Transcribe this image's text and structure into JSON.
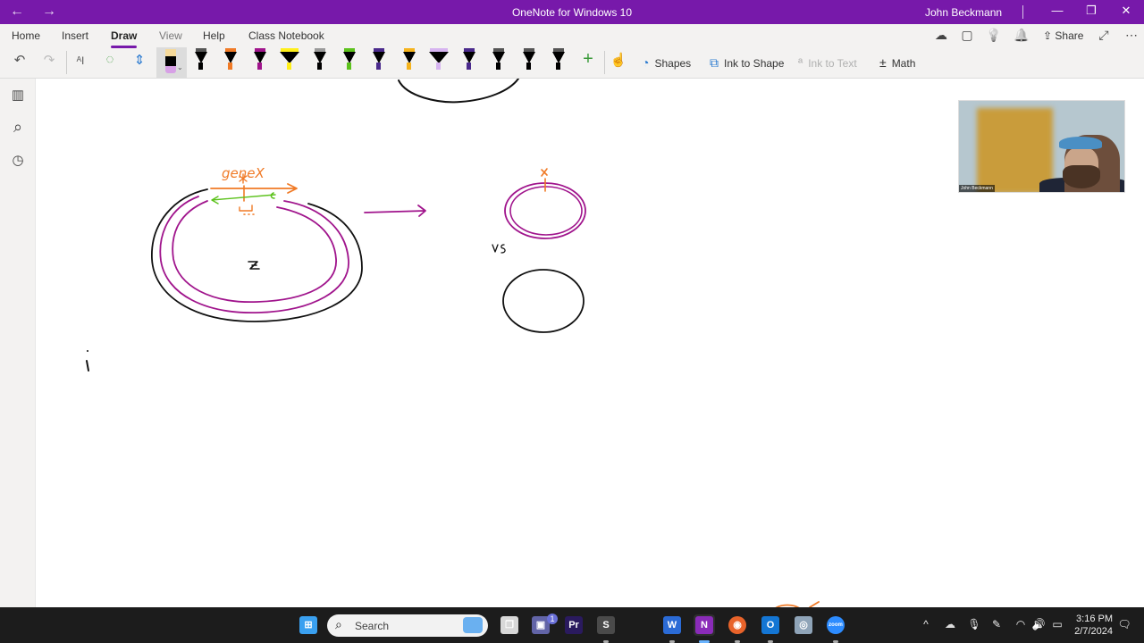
{
  "titlebar": {
    "back_icon": "arrow-left",
    "forward_icon": "arrow-right",
    "title": "OneNote for Windows 10",
    "user": "John Beckmann",
    "minimize_glyph": "—",
    "restore_glyph": "❐",
    "close_glyph": "✕",
    "back_glyph": "←",
    "forward_glyph": "→"
  },
  "ribbon": {
    "tabs": [
      {
        "label": "Home"
      },
      {
        "label": "Insert"
      },
      {
        "label": "Draw",
        "active": true
      },
      {
        "label": "View"
      },
      {
        "label": "Help"
      },
      {
        "label": "Class Notebook"
      }
    ],
    "top_right": {
      "sync_glyph": "☁",
      "pages_glyph": "▢",
      "tell_me_glyph": "💡",
      "notifications_glyph": "🔔",
      "share_label": "Share",
      "share_glyph": "⇪",
      "fullscreen_glyph": "⤢",
      "more_glyph": "⋯"
    },
    "tools": {
      "undo_glyph": "↶",
      "redo_glyph": "↷",
      "type_select_glyph": "ᴬI",
      "lasso_glyph": "◌",
      "add_space_glyph": "⇕",
      "add_pen_glyph": "+",
      "touch_draw_glyph": "☝",
      "shapes_label": "Shapes",
      "shapes_glyph": "◔",
      "ink_to_shape_label": "Ink to Shape",
      "ink_to_shape_glyph": "⧉",
      "ink_to_text_label": "Ink to Text",
      "ink_to_text_glyph": "ª",
      "math_label": "Math",
      "math_glyph": "±"
    },
    "pens": [
      {
        "kind": "pen",
        "cap": "#555555",
        "tip": "#000000"
      },
      {
        "kind": "pen",
        "cap": "#f07a26",
        "tip": "#f07a26"
      },
      {
        "kind": "pen",
        "cap": "#a0148c",
        "tip": "#a0148c"
      },
      {
        "kind": "highlighter",
        "cap": "#ffef1a",
        "tip": "#ffef1a"
      },
      {
        "kind": "pen",
        "cap": "#9a9a9a",
        "tip": "#000000"
      },
      {
        "kind": "pen",
        "cap": "#5cc21c",
        "tip": "#5cc21c"
      },
      {
        "kind": "pen",
        "cap": "#4a2a8c",
        "tip": "#4a2a8c"
      },
      {
        "kind": "pen",
        "cap": "#f5b31c",
        "tip": "#f5b31c"
      },
      {
        "kind": "highlighter",
        "cap": "#d6b4f0",
        "tip": "#d6b4f0"
      },
      {
        "kind": "pen",
        "cap": "#4a2a8c",
        "tip": "#4a2a8c"
      },
      {
        "kind": "pen",
        "cap": "#555555",
        "tip": "#000000"
      },
      {
        "kind": "pen",
        "cap": "#555555",
        "tip": "#000000"
      },
      {
        "kind": "pen",
        "cap": "#555555",
        "tip": "#000000"
      }
    ]
  },
  "leftnav": {
    "notebooks_glyph": "▥",
    "search_glyph": "⌕",
    "recent_glyph": "◷"
  },
  "canvas": {
    "labels": {
      "gene": "geneX",
      "vs": "vs",
      "z": "z",
      "i": "i"
    },
    "ink_colors": {
      "black": "#111111",
      "magenta": "#a0148c",
      "orange": "#f07a26",
      "green": "#5cc21c"
    }
  },
  "webcam": {
    "name": "John Beckmann"
  },
  "taskbar": {
    "search_placeholder": "Search",
    "search_glyph": "🔍",
    "teams_badge": "1",
    "apps": [
      {
        "name": "start",
        "color": "#3aa0f0",
        "label": "⊞"
      },
      {
        "name": "task-view",
        "color": "#d8d8d8",
        "label": "❐"
      },
      {
        "name": "teams-chat",
        "color": "#6264a7",
        "label": "▣"
      },
      {
        "name": "premiere-pro",
        "color": "#2a1a5e",
        "label": "Pr"
      },
      {
        "name": "sublime-text",
        "color": "#4a4a4a",
        "label": "S"
      },
      {
        "name": "word",
        "color": "#2b6bd6",
        "label": "W"
      },
      {
        "name": "onenote",
        "color": "#8a2bb8",
        "label": "N"
      },
      {
        "name": "firefox",
        "color": "#e8632a",
        "label": "◉"
      },
      {
        "name": "outlook",
        "color": "#1476d4",
        "label": "O"
      },
      {
        "name": "control-app",
        "color": "#8fa4b8",
        "label": "◎"
      },
      {
        "name": "zoom",
        "color": "#2d8cff",
        "label": "zoom"
      }
    ],
    "tray": {
      "chevron_glyph": "^",
      "onedrive_glyph": "☁",
      "mic_glyph": "🎙",
      "pen_glyph": "✎",
      "wifi_glyph": "◠",
      "volume_glyph": "🔊",
      "battery_glyph": "▭",
      "notification_glyph": "🗨"
    },
    "time": "3:16 PM",
    "date": "2/7/2024"
  }
}
